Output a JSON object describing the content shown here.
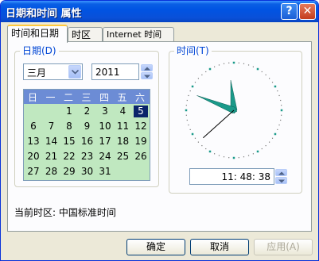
{
  "window": {
    "title": "日期和时间 属性",
    "help_glyph": "?",
    "close_glyph": "✕"
  },
  "tabs": [
    {
      "label": "时间和日期",
      "active": true
    },
    {
      "label": "时区",
      "active": false
    },
    {
      "label": "Internet 时间",
      "active": false
    }
  ],
  "date_group": {
    "title": "日期(D)",
    "month": "三月",
    "year": "2011",
    "weekdays": [
      "日",
      "一",
      "二",
      "三",
      "四",
      "五",
      "六"
    ],
    "selected_day": "5",
    "rows": [
      [
        "",
        "",
        "",
        "1",
        "2",
        "3",
        "4",
        "5"
      ],
      [
        "6",
        "7",
        "8",
        "9",
        "10",
        "11",
        "12"
      ],
      [
        "13",
        "14",
        "15",
        "16",
        "17",
        "18",
        "19"
      ],
      [
        "20",
        "21",
        "22",
        "23",
        "24",
        "25",
        "26"
      ],
      [
        "27",
        "28",
        "29",
        "30",
        "31",
        "",
        ""
      ]
    ]
  },
  "time_group": {
    "title": "时间(T)",
    "time": "11: 48: 38",
    "hour": 11,
    "minute": 48,
    "second": 38
  },
  "timezone": {
    "label": "当前时区:",
    "value": "中国标准时间"
  },
  "buttons": {
    "ok": "确定",
    "cancel": "取消",
    "apply": "应用(A)"
  },
  "colors": {
    "title_bar": "#0054e3",
    "calendar_bg": "#c0e8c0",
    "calendar_header": "#6c8cd5",
    "hand_fill": "#1a9a8a",
    "group_title": "#0046d5"
  }
}
